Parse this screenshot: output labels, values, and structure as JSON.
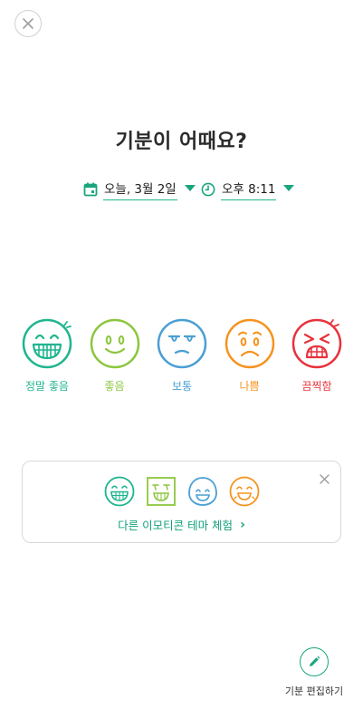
{
  "header": {
    "title": "기분이 어때요?",
    "close_icon": "close-icon"
  },
  "date_picker": {
    "value": "오늘, 3월 2일",
    "icon": "calendar-icon"
  },
  "time_picker": {
    "value": "오후 8:11",
    "icon": "clock-icon"
  },
  "moods": [
    {
      "label": "정말 좋음",
      "color": "#1fb58f",
      "icon": "rad-face-icon"
    },
    {
      "label": "좋음",
      "color": "#8cc63f",
      "icon": "good-face-icon"
    },
    {
      "label": "보통",
      "color": "#4a9fd4",
      "icon": "meh-face-icon"
    },
    {
      "label": "나쁨",
      "color": "#f5931e",
      "icon": "bad-face-icon"
    },
    {
      "label": "끔찍함",
      "color": "#e8323c",
      "icon": "awful-face-icon"
    }
  ],
  "theme_card": {
    "link_label": "다른 이모티콘 테마 체험",
    "preview_colors": [
      "#1fb58f",
      "#8cc63f",
      "#4a9fd4",
      "#f5931e"
    ]
  },
  "edit_button": {
    "label": "기분 편집하기",
    "icon": "pencil-icon"
  },
  "colors": {
    "accent": "#1aa57e"
  }
}
